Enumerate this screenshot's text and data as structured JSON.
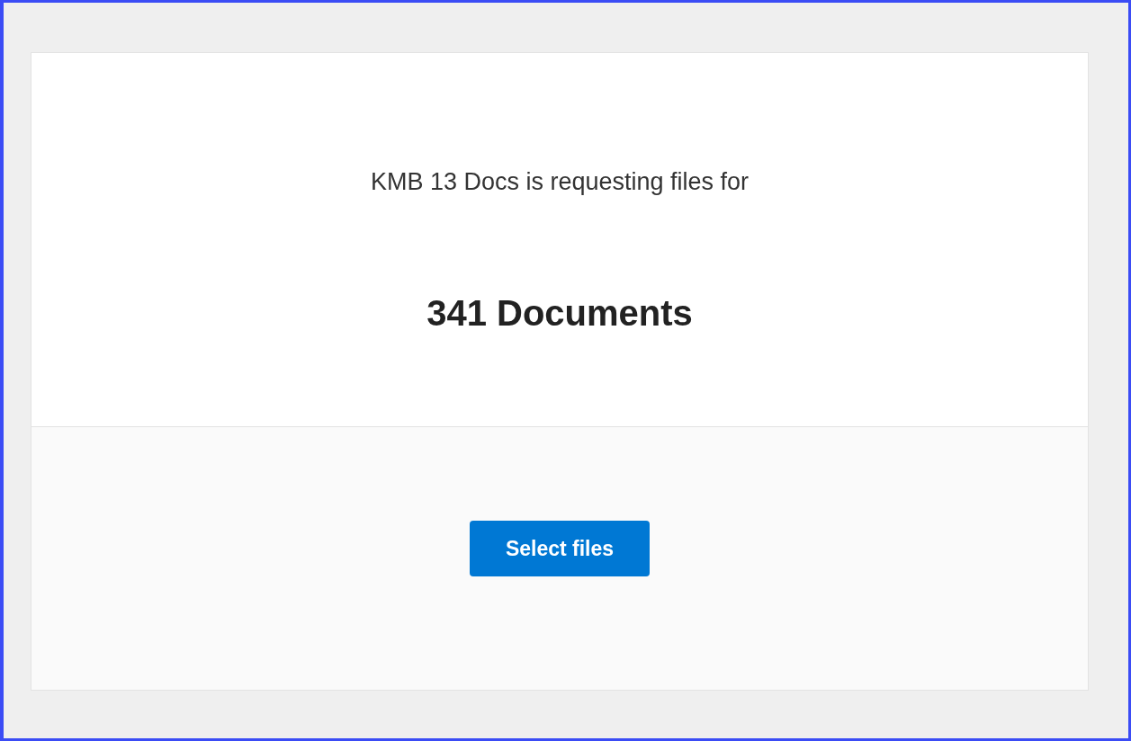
{
  "request": {
    "intro": "KMB 13 Docs is requesting files for",
    "title": "341 Documents"
  },
  "action": {
    "button": "Select files"
  }
}
